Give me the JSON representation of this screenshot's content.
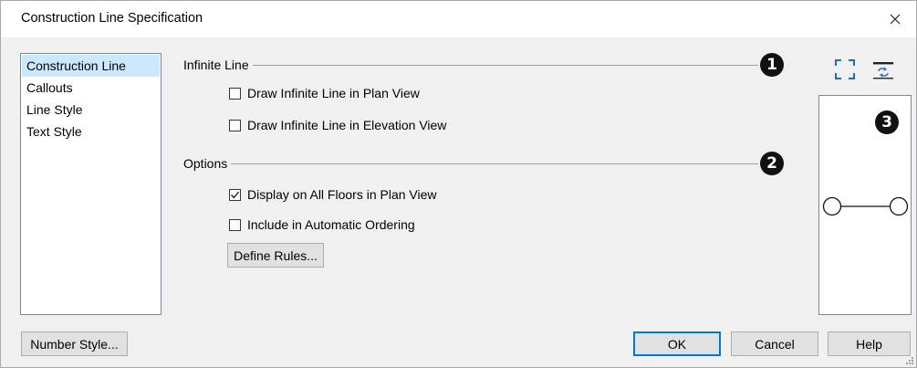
{
  "window": {
    "title": "Construction Line Specification"
  },
  "nav": {
    "items": [
      {
        "label": "Construction Line",
        "selected": true
      },
      {
        "label": "Callouts",
        "selected": false
      },
      {
        "label": "Line Style",
        "selected": false
      },
      {
        "label": "Text Style",
        "selected": false
      }
    ]
  },
  "infinite_line": {
    "heading": "Infinite Line",
    "badge": "1",
    "draw_plan": {
      "label": "Draw Infinite Line in Plan View",
      "checked": false
    },
    "draw_elevation": {
      "label": "Draw Infinite Line in Elevation View",
      "checked": false
    }
  },
  "options": {
    "heading": "Options",
    "badge": "2",
    "display_all_floors": {
      "label": "Display on All Floors in Plan View",
      "checked": true
    },
    "include_ordering": {
      "label": "Include in Automatic Ordering",
      "checked": false
    },
    "define_rules_label": "Define Rules..."
  },
  "preview": {
    "badge": "3",
    "icons": [
      "fill-window-icon",
      "toggle-view-icon"
    ]
  },
  "footer": {
    "number_style_label": "Number Style...",
    "ok_label": "OK",
    "cancel_label": "Cancel",
    "help_label": "Help"
  },
  "colors": {
    "accent": "#0078d7",
    "selection": "#cce8ff",
    "icon_blue": "#1a6fc4"
  }
}
